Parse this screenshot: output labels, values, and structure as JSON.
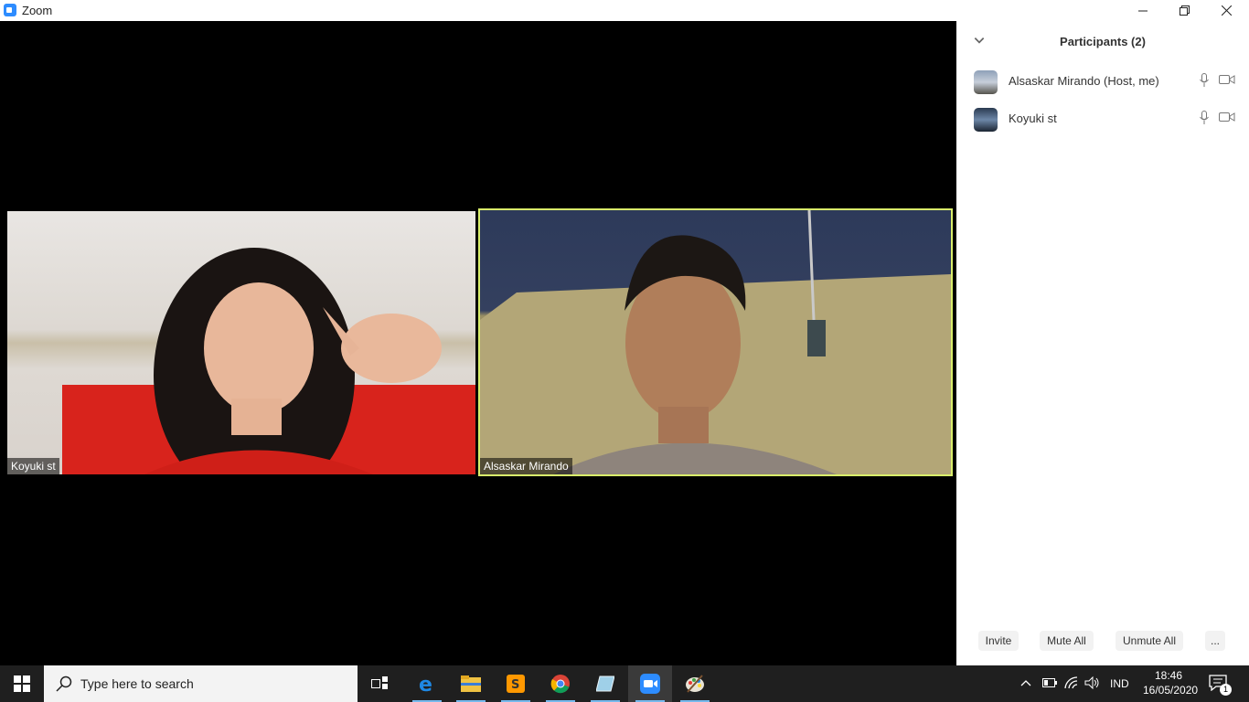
{
  "window": {
    "title": "Zoom",
    "minimize_label": "—",
    "restore_label": "❐",
    "close_label": "✕"
  },
  "videos": [
    {
      "name": "Koyuki st",
      "active_speaker": false
    },
    {
      "name": "Alsaskar Mirando",
      "active_speaker": true
    }
  ],
  "participants_panel": {
    "title": "Participants (2)",
    "participants": [
      {
        "name": "Alsaskar Mirando (Host, me)",
        "mic_icon": "microphone-icon",
        "camera_icon": "video-camera-icon"
      },
      {
        "name": "Koyuki st",
        "mic_icon": "microphone-icon",
        "camera_icon": "video-camera-icon"
      }
    ],
    "buttons": {
      "invite": "Invite",
      "mute_all": "Mute All",
      "unmute_all": "Unmute All",
      "more": "..."
    }
  },
  "taskbar": {
    "search_placeholder": "Type here to search",
    "apps": [
      "task-view",
      "edge",
      "file-explorer",
      "sublime-text",
      "chrome",
      "notepad",
      "zoom",
      "paint"
    ],
    "active_app": "zoom",
    "language": "IND",
    "time": "18:46",
    "date": "16/05/2020",
    "notification_count": "1"
  },
  "colors": {
    "accent": "#2d8cff",
    "active_speaker_border": "#d9ee6b",
    "taskbar": "#1f1f1f"
  }
}
